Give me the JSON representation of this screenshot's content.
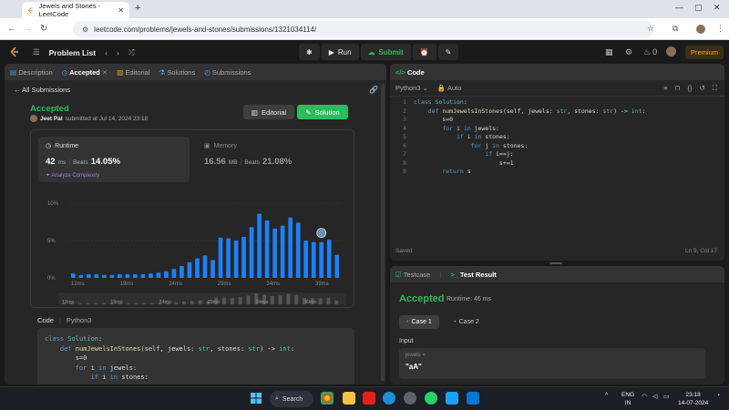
{
  "browser": {
    "tab_title": "Jewels and Stones - LeetCode",
    "url": "leetcode.com/problems/jewels-and-stones/submissions/1321034114/"
  },
  "topbar": {
    "problem_list": "Problem List",
    "run": "Run",
    "submit": "Submit",
    "streak": "0",
    "premium": "Premium"
  },
  "left_tabs": [
    "Description",
    "Accepted",
    "Editorial",
    "Solutions",
    "Submissions"
  ],
  "submission": {
    "back": "All Submissions",
    "status": "Accepted",
    "user": "Jeet Pal",
    "submitted": "submitted at Jul 14, 2024 23:18",
    "editorial_btn": "Editorial",
    "solution_btn": "Solution"
  },
  "runtime": {
    "label": "Runtime",
    "value": "42",
    "unit": "ms",
    "beats_label": "Beats",
    "beats": "14.05%",
    "analyze": "Analyze Complexity"
  },
  "memory": {
    "label": "Memory",
    "value": "16.56",
    "unit": "MB",
    "beats_label": "Beats",
    "beats": "21.08%"
  },
  "chart_data": {
    "type": "bar",
    "ylabel_ticks": [
      "10%",
      "5%",
      "0%"
    ],
    "ylim": [
      0,
      10
    ],
    "x_tick_labels": [
      "12ms",
      "19ms",
      "24ms",
      "29ms",
      "34ms",
      "39ms"
    ],
    "values": [
      0.6,
      0.4,
      0.5,
      0.5,
      0.4,
      0.4,
      0.5,
      0.5,
      0.5,
      0.5,
      0.6,
      0.7,
      0.9,
      1.2,
      1.6,
      2.1,
      2.6,
      3.0,
      2.4,
      5.4,
      5.3,
      5.0,
      5.5,
      6.8,
      8.6,
      7.7,
      6.6,
      7.0,
      8.1,
      7.4,
      5.0,
      4.8,
      4.8,
      5.1,
      3.1
    ],
    "user_bar_index": 32
  },
  "code_section": {
    "label": "Code",
    "lang": "Python3",
    "lines": [
      "class Solution:",
      "    def numJewelsInStones(self, jewels: str, stones: str) -> int:",
      "        s=0",
      "        for i in jewels:",
      "            if i in stones:"
    ]
  },
  "editor": {
    "tab": "Code",
    "lang": "Python3",
    "mode": "Auto",
    "lines": [
      "class Solution:",
      "    def numJewelsInStones(self, jewels: str, stones: str) -> int:",
      "        s=0",
      "        for i in jewels:",
      "            if i in stones:",
      "                for j in stones:",
      "                    if i==j:",
      "                        s+=1",
      "        return s"
    ],
    "saved": "Saved",
    "position": "Ln 9, Col 17"
  },
  "result": {
    "tabs": [
      "Testcase",
      "Test Result"
    ],
    "status": "Accepted",
    "runtime": "Runtime: 46 ms",
    "cases": [
      "Case 1",
      "Case 2"
    ],
    "input_label": "Input",
    "var": "jewels =",
    "value": "\"aA\""
  },
  "taskbar": {
    "search": "Search",
    "lang1": "ENG",
    "lang2": "IN",
    "time": "23:18",
    "date": "14-07-2024"
  }
}
